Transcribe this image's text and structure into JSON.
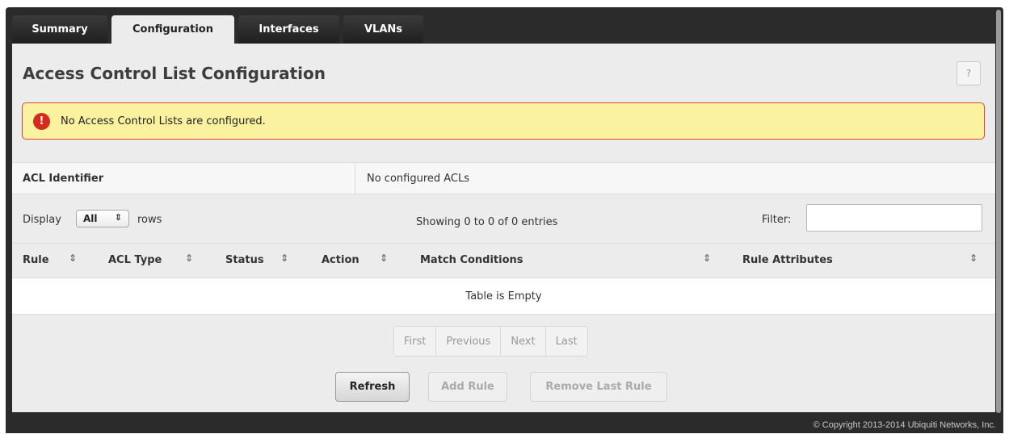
{
  "tabs": [
    {
      "label": "Summary"
    },
    {
      "label": "Configuration"
    },
    {
      "label": "Interfaces"
    },
    {
      "label": "VLANs"
    }
  ],
  "page": {
    "title": "Access Control List Configuration",
    "help_label": "?"
  },
  "alert": {
    "icon": "!",
    "message": "No Access Control Lists are configured."
  },
  "acl": {
    "label": "ACL Identifier",
    "value": "No configured ACLs"
  },
  "controls": {
    "display_label": "Display",
    "display_value": "All",
    "rows_label": "rows",
    "showing": "Showing 0 to 0 of 0 entries",
    "filter_label": "Filter:",
    "filter_value": ""
  },
  "table": {
    "columns": [
      "Rule",
      "ACL Type",
      "Status",
      "Action",
      "Match Conditions",
      "Rule Attributes"
    ],
    "empty_text": "Table is Empty"
  },
  "pagination": [
    "First",
    "Previous",
    "Next",
    "Last"
  ],
  "buttons": {
    "refresh": "Refresh",
    "add_rule": "Add Rule",
    "remove_last_rule": "Remove Last Rule"
  },
  "footer": {
    "copyright": "© Copyright 2013-2014 Ubiquiti Networks, Inc."
  }
}
